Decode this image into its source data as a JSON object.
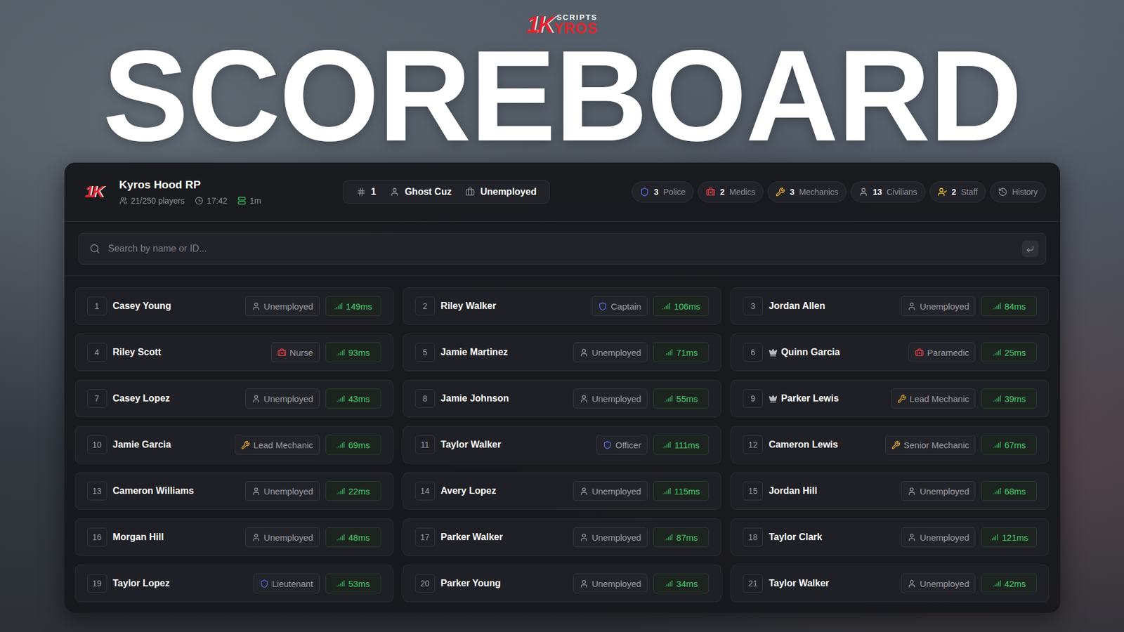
{
  "logo": {
    "mark": "1K",
    "top": "SCRIPTS",
    "bottom": "YROS"
  },
  "title": "SCOREBOARD",
  "server": {
    "mark": "1K",
    "name": "Kyros Hood RP",
    "players": "21/250 players",
    "time": "17:42",
    "uptime": "1m"
  },
  "self": {
    "id": "1",
    "name": "Ghost Cuz",
    "job": "Unemployed"
  },
  "stats": [
    {
      "count": "3",
      "label": "Police",
      "kind": "police",
      "color": "#5b6ef2"
    },
    {
      "count": "2",
      "label": "Medics",
      "kind": "medic",
      "color": "#e5414b"
    },
    {
      "count": "3",
      "label": "Mechanics",
      "kind": "mechanic",
      "color": "#f0b429"
    },
    {
      "count": "13",
      "label": "Civilians",
      "kind": "civilian",
      "color": "#9a9ca3"
    },
    {
      "count": "2",
      "label": "Staff",
      "kind": "staff",
      "color": "#f2c418"
    }
  ],
  "history": {
    "label": "History"
  },
  "search": {
    "placeholder": "Search by name or ID..."
  },
  "players": [
    {
      "id": "1",
      "name": "Casey Young",
      "crown": false,
      "job": "Unemployed",
      "kind": "unemployed",
      "color": "#9a9ca3",
      "ping": "149ms"
    },
    {
      "id": "2",
      "name": "Riley Walker",
      "crown": false,
      "job": "Captain",
      "kind": "police",
      "color": "#5b6ef2",
      "ping": "106ms"
    },
    {
      "id": "3",
      "name": "Jordan Allen",
      "crown": false,
      "job": "Unemployed",
      "kind": "unemployed",
      "color": "#9a9ca3",
      "ping": "84ms"
    },
    {
      "id": "4",
      "name": "Riley Scott",
      "crown": false,
      "job": "Nurse",
      "kind": "medic",
      "color": "#e5414b",
      "ping": "93ms"
    },
    {
      "id": "5",
      "name": "Jamie Martinez",
      "crown": false,
      "job": "Unemployed",
      "kind": "unemployed",
      "color": "#9a9ca3",
      "ping": "71ms"
    },
    {
      "id": "6",
      "name": "Quinn Garcia",
      "crown": true,
      "job": "Paramedic",
      "kind": "medic",
      "color": "#e5414b",
      "ping": "25ms"
    },
    {
      "id": "7",
      "name": "Casey Lopez",
      "crown": false,
      "job": "Unemployed",
      "kind": "unemployed",
      "color": "#9a9ca3",
      "ping": "43ms"
    },
    {
      "id": "8",
      "name": "Jamie Johnson",
      "crown": false,
      "job": "Unemployed",
      "kind": "unemployed",
      "color": "#9a9ca3",
      "ping": "55ms"
    },
    {
      "id": "9",
      "name": "Parker Lewis",
      "crown": true,
      "job": "Lead Mechanic",
      "kind": "mechanic",
      "color": "#f0b429",
      "ping": "39ms"
    },
    {
      "id": "10",
      "name": "Jamie Garcia",
      "crown": false,
      "job": "Lead Mechanic",
      "kind": "mechanic",
      "color": "#f0b429",
      "ping": "69ms"
    },
    {
      "id": "11",
      "name": "Taylor Walker",
      "crown": false,
      "job": "Officer",
      "kind": "police",
      "color": "#5b6ef2",
      "ping": "111ms"
    },
    {
      "id": "12",
      "name": "Cameron Lewis",
      "crown": false,
      "job": "Senior Mechanic",
      "kind": "mechanic",
      "color": "#f0b429",
      "ping": "67ms"
    },
    {
      "id": "13",
      "name": "Cameron Williams",
      "crown": false,
      "job": "Unemployed",
      "kind": "unemployed",
      "color": "#9a9ca3",
      "ping": "22ms"
    },
    {
      "id": "14",
      "name": "Avery Lopez",
      "crown": false,
      "job": "Unemployed",
      "kind": "unemployed",
      "color": "#9a9ca3",
      "ping": "115ms"
    },
    {
      "id": "15",
      "name": "Jordan Hill",
      "crown": false,
      "job": "Unemployed",
      "kind": "unemployed",
      "color": "#9a9ca3",
      "ping": "68ms"
    },
    {
      "id": "16",
      "name": "Morgan Hill",
      "crown": false,
      "job": "Unemployed",
      "kind": "unemployed",
      "color": "#9a9ca3",
      "ping": "48ms"
    },
    {
      "id": "17",
      "name": "Parker Walker",
      "crown": false,
      "job": "Unemployed",
      "kind": "unemployed",
      "color": "#9a9ca3",
      "ping": "87ms"
    },
    {
      "id": "18",
      "name": "Taylor Clark",
      "crown": false,
      "job": "Unemployed",
      "kind": "unemployed",
      "color": "#9a9ca3",
      "ping": "121ms"
    },
    {
      "id": "19",
      "name": "Taylor Lopez",
      "crown": false,
      "job": "Lieutenant",
      "kind": "police",
      "color": "#5b6ef2",
      "ping": "53ms"
    },
    {
      "id": "20",
      "name": "Parker Young",
      "crown": false,
      "job": "Unemployed",
      "kind": "unemployed",
      "color": "#9a9ca3",
      "ping": "34ms"
    },
    {
      "id": "21",
      "name": "Taylor Walker",
      "crown": false,
      "job": "Unemployed",
      "kind": "unemployed",
      "color": "#9a9ca3",
      "ping": "42ms"
    }
  ]
}
